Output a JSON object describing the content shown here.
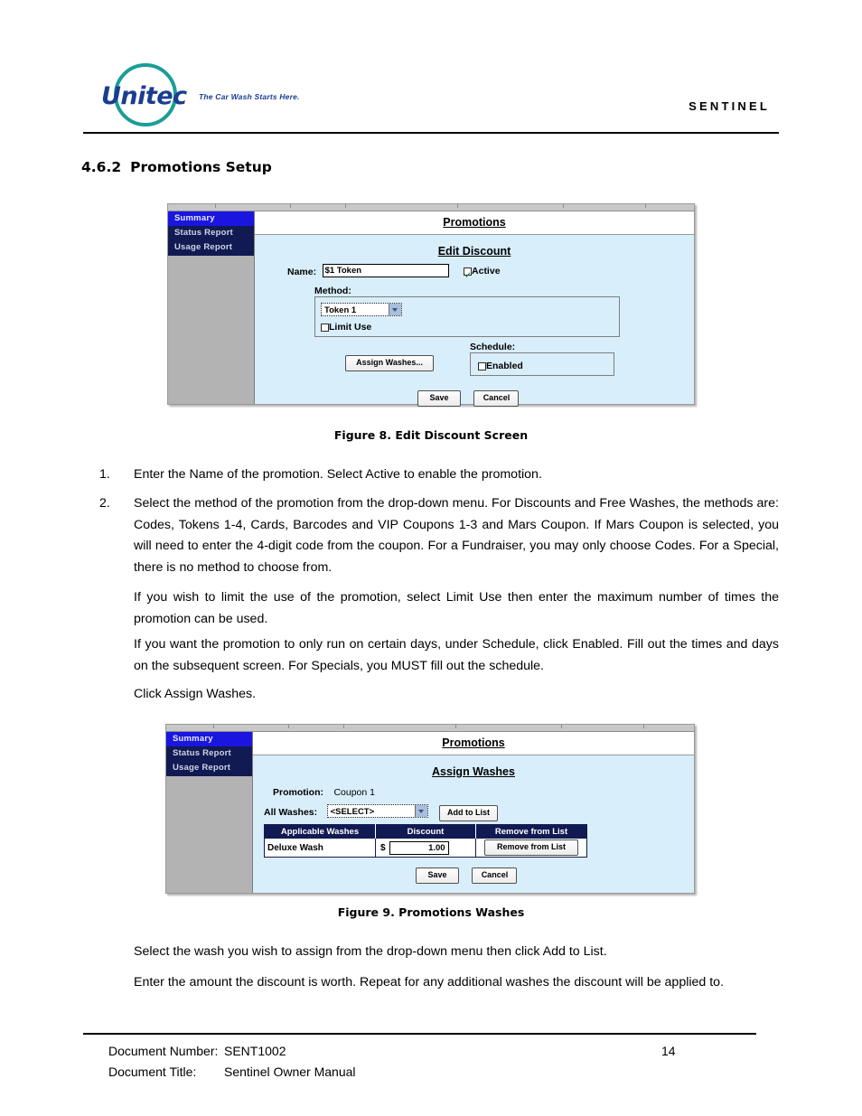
{
  "header": {
    "logo_word": "Unitec",
    "logo_tagline": "The Car Wash Starts Here.",
    "product": "SENTINEL"
  },
  "section": {
    "number": "4.6.2",
    "title": "Promotions Setup"
  },
  "figure8": {
    "caption": "Figure 8. Edit Discount Screen",
    "sidebar": {
      "items": [
        {
          "label": "Summary",
          "active": true
        },
        {
          "label": "Status Report",
          "active": false
        },
        {
          "label": "Usage Report",
          "active": false
        }
      ]
    },
    "app_title": "Promotions",
    "screen_title": "Edit Discount",
    "name_label": "Name:",
    "name_value": "$1 Token",
    "active_label": "Active",
    "active_checked": true,
    "method_label": "Method:",
    "method_value": "Token 1",
    "limit_use_label": "Limit Use",
    "limit_use_checked": false,
    "assign_washes_button": "Assign Washes...",
    "schedule_label": "Schedule:",
    "schedule_enabled_label": "Enabled",
    "schedule_enabled_checked": false,
    "save_button": "Save",
    "cancel_button": "Cancel"
  },
  "figure9": {
    "caption": "Figure 9. Promotions Washes",
    "sidebar": {
      "items": [
        {
          "label": "Summary",
          "active": true
        },
        {
          "label": "Status Report",
          "active": false
        },
        {
          "label": "Usage Report",
          "active": false
        }
      ]
    },
    "app_title": "Promotions",
    "screen_title": "Assign Washes",
    "promotion_label": "Promotion:",
    "promotion_value": "Coupon 1",
    "all_washes_label": "All Washes:",
    "all_washes_value": "<SELECT>",
    "add_to_list_button": "Add to List",
    "table": {
      "headers": [
        "Applicable Washes",
        "Discount",
        "Remove from List"
      ],
      "rows": [
        {
          "wash": "Deluxe Wash",
          "currency": "$",
          "discount": "1.00",
          "remove_button": "Remove from List"
        }
      ]
    },
    "save_button": "Save",
    "cancel_button": "Cancel"
  },
  "body": {
    "item1_num": "1.",
    "item1_text": "Enter the Name of the promotion. Select Active to enable the promotion.",
    "item2_num": "2.",
    "item2_text": "Select the method of the promotion from the drop-down menu. For Discounts and Free Washes, the methods are: Codes, Tokens 1-4, Cards, Barcodes and VIP Coupons 1-3 and Mars Coupon. If Mars Coupon is selected, you will need to enter the 4-digit code from the coupon. For a Fundraiser, you may only choose Codes. For a Special, there is no method to choose from.",
    "para_limit": "If you wish to limit the use of the promotion, select Limit Use then enter the maximum number of times the promotion can be used.",
    "para_schedule": "If you want the promotion to only run on certain days, under Schedule, click Enabled. Fill out the times and days on the subsequent screen. For Specials, you MUST fill out the schedule.",
    "para_click_assign": "Click Assign Washes.",
    "para_select_wash": "Select the wash you wish to assign from the drop-down menu then click Add to List.",
    "para_enter_amount": "Enter the amount the discount is worth. Repeat for any additional washes the discount will be applied to."
  },
  "footer": {
    "doc_number_label": "Document Number:",
    "doc_number_value": "SENT1002",
    "doc_title_label": "Document Title:",
    "doc_title_value": "Sentinel Owner Manual",
    "page_number": "14"
  }
}
